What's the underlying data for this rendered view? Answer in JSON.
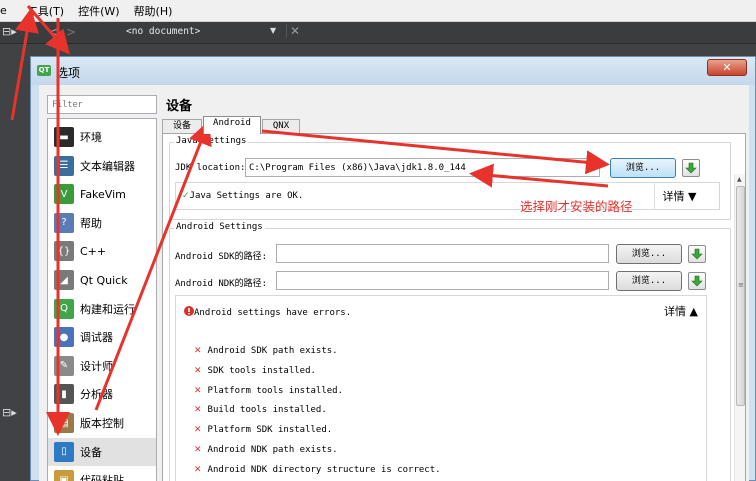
{
  "menubar": {
    "items": [
      {
        "label": "e"
      },
      {
        "label": "工具(T)"
      },
      {
        "label": "控件(W)"
      },
      {
        "label": "帮助(H)"
      }
    ]
  },
  "editor_bar": {
    "split_icon": "⊟▸",
    "nav_back": "<",
    "nav_forward": ">",
    "document": "<no document>",
    "dropdown": "▼",
    "close": "✕"
  },
  "dialog": {
    "title": "选项",
    "close": "✕",
    "filter_placeholder": "Filter",
    "categories": [
      {
        "label": "环境",
        "icon": "monitor-icon",
        "color": "#2b2b2b"
      },
      {
        "label": "文本编辑器",
        "icon": "text-editor-icon",
        "color": "#3a6e9e"
      },
      {
        "label": "FakeVim",
        "icon": "fakevim-icon",
        "color": "#3b9b3b"
      },
      {
        "label": "帮助",
        "icon": "help-icon",
        "color": "#5a7bb5"
      },
      {
        "label": "C++",
        "icon": "cpp-icon",
        "color": "#7a7a7a"
      },
      {
        "label": "Qt Quick",
        "icon": "qt-quick-icon",
        "color": "#7a7a7a"
      },
      {
        "label": "构建和运行",
        "icon": "build-run-icon",
        "color": "#41a54b"
      },
      {
        "label": "调试器",
        "icon": "debugger-icon",
        "color": "#4a72b8"
      },
      {
        "label": "设计师",
        "icon": "designer-icon",
        "color": "#8a8a8a"
      },
      {
        "label": "分析器",
        "icon": "analyzer-icon",
        "color": "#555555"
      },
      {
        "label": "版本控制",
        "icon": "version-control-icon",
        "color": "#9a7a4a"
      },
      {
        "label": "设备",
        "icon": "devices-icon",
        "color": "#2e7bc4",
        "selected": true
      },
      {
        "label": "代码粘贴",
        "icon": "code-paste-icon",
        "color": "#c89b3c"
      }
    ],
    "page_title": "设备",
    "tabs": [
      {
        "label": "设备",
        "active": false
      },
      {
        "label": "Android",
        "active": true
      },
      {
        "label": "QNX",
        "active": false
      }
    ],
    "java": {
      "group_title": "Java Settings",
      "jdk_label": "JDK location:",
      "jdk_value": "C:\\Program Files (x86)\\Java\\jdk1.8.0_144",
      "browse": "浏览...",
      "status": "Java Settings are OK.",
      "details": "详情 ▼"
    },
    "android": {
      "group_title": "Android Settings",
      "sdk_label": "Android SDK的路径:",
      "sdk_value": "",
      "ndk_label": "Android NDK的路径:",
      "ndk_value": "",
      "browse": "浏览...",
      "status": "Android settings have errors.",
      "details": "详情 ▲",
      "checks": [
        "Android SDK path exists.",
        "SDK tools installed.",
        "Platform tools installed.",
        "Build tools installed.",
        "Platform SDK installed.",
        "Android NDK path exists.",
        "Android NDK directory structure is correct."
      ]
    }
  },
  "annotation": {
    "text": "选择刚才安装的路径",
    "color": "#e8322c"
  },
  "lower_split_icon": "⊟▸"
}
